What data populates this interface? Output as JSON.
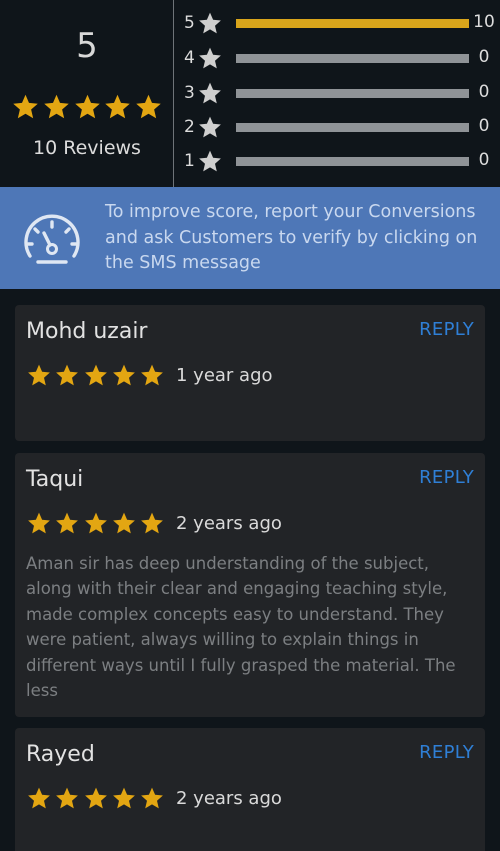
{
  "summary": {
    "average": "5",
    "average_stars": 5,
    "review_count_label": "10 Reviews",
    "accent_color": "#e3a612",
    "bars": [
      {
        "rating_label": "5",
        "count": "10",
        "fraction": 1.0
      },
      {
        "rating_label": "4",
        "count": "0",
        "fraction": 0
      },
      {
        "rating_label": "3",
        "count": "0",
        "fraction": 0
      },
      {
        "rating_label": "2",
        "count": "0",
        "fraction": 0
      },
      {
        "rating_label": "1",
        "count": "0",
        "fraction": 0
      }
    ]
  },
  "banner": {
    "icon": "speedometer-icon",
    "text": "To improve score, report your Conversions and ask Customers to verify by clicking on the SMS message",
    "background_color": "#4e77b7"
  },
  "reviews": [
    {
      "name": "Mohd uzair",
      "reply_label": "REPLY",
      "stars": 5,
      "time": "1 year ago",
      "text": ""
    },
    {
      "name": "Taqui",
      "reply_label": "REPLY",
      "stars": 5,
      "time": "2 years ago",
      "text": "Aman sir has deep understanding of the subject, along with their clear and engaging teaching style, made complex concepts easy to understand. They were patient, always willing to explain things in different ways until I fully grasped the material. The less"
    },
    {
      "name": "Rayed",
      "reply_label": "REPLY",
      "stars": 5,
      "time": "2 years ago",
      "text": ""
    }
  ],
  "link_color": "#2f7fd6"
}
